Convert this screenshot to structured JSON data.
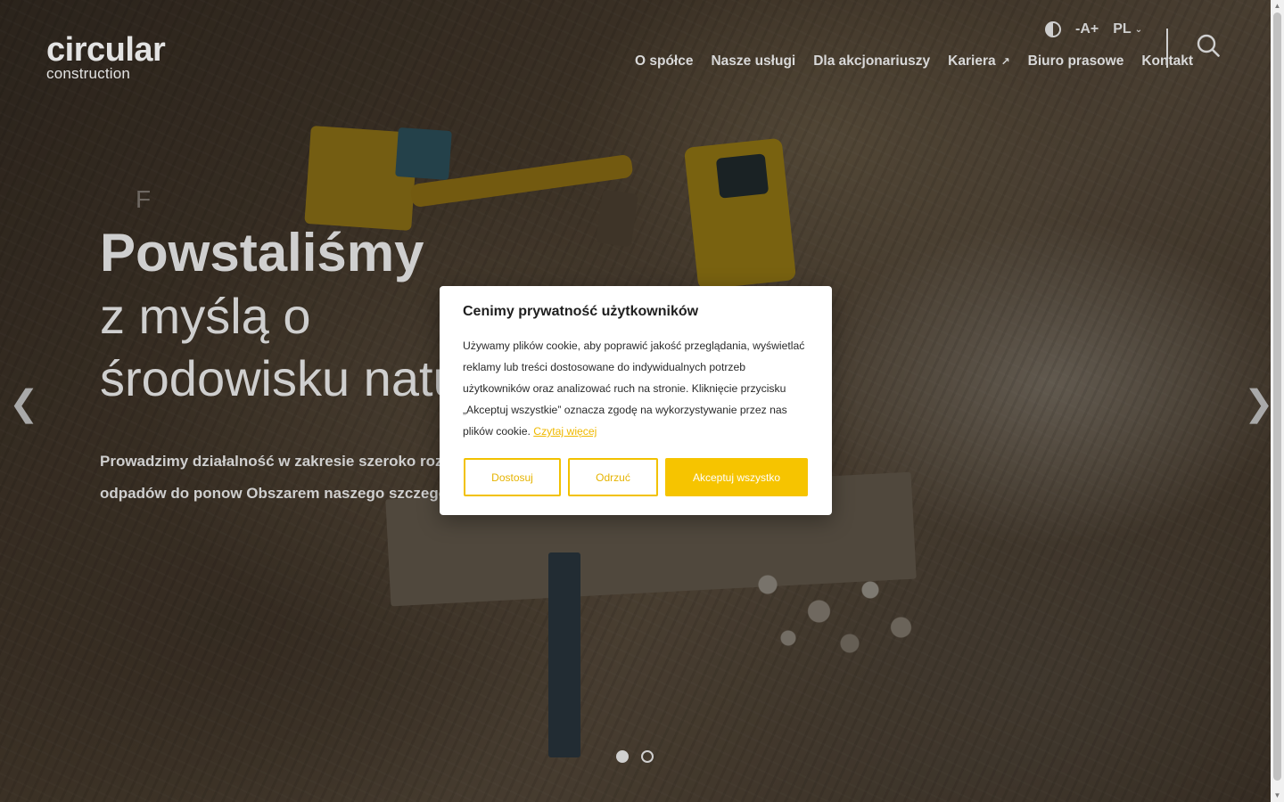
{
  "brand": {
    "logo_main": "circular",
    "logo_sub": "construction"
  },
  "utility": {
    "font_size_label": "-A+",
    "language": "PL"
  },
  "nav": {
    "items": [
      {
        "label": "O spółce"
      },
      {
        "label": "Nasze usługi"
      },
      {
        "label": "Dla akcjonariuszy"
      },
      {
        "label": "Kariera",
        "external": true
      },
      {
        "label": "Biuro prasowe"
      },
      {
        "label": "Kontakt"
      }
    ]
  },
  "hero": {
    "eyebrow": "F",
    "headline_line1": "Powstaliśmy",
    "headline_line2": "z myślą o",
    "headline_line3": "środowisku natu",
    "lead": "Prowadzimy działalność w zakresie szeroko rozumia magazynowania i przetwarzania odpadów do ponow Obszarem naszego szczególnego zainteresowania są odpady budowlane.",
    "slides_total": 2,
    "active_slide": 1
  },
  "cookie": {
    "title": "Cenimy prywatność użytkowników",
    "text": "Używamy plików cookie, aby poprawić jakość przeglądania, wyświetlać reklamy lub treści dostosowane do indywidualnych potrzeb użytkowników oraz analizować ruch na stronie. Kliknięcie przycisku „Akceptuj wszystkie” oznacza zgodę na wykorzystywanie przez nas plików cookie. ",
    "read_more": "Czytaj więcej",
    "btn_customize": "Dostosuj",
    "btn_reject": "Odrzuć",
    "btn_accept": "Akceptuj wszystko"
  },
  "colors": {
    "accent": "#f6c400",
    "overlay": "#000000"
  }
}
